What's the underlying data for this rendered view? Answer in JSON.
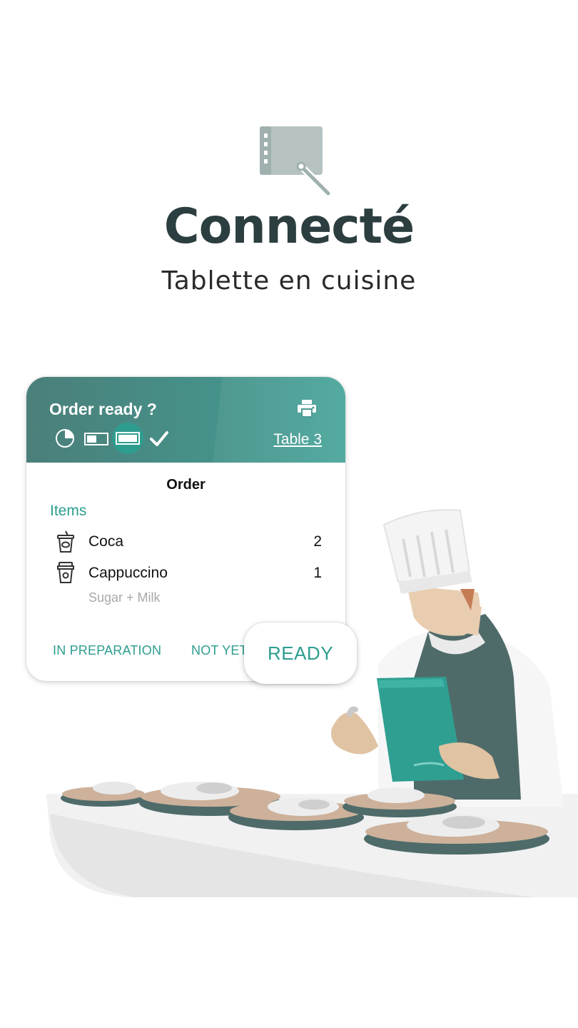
{
  "hero": {
    "icon": "kitchen-tablet-icon",
    "title": "Connecté",
    "subtitle": "Tablette en cuisine"
  },
  "order_card": {
    "header_title": "Order ready ?",
    "table_label": "Table 3",
    "status_steps": [
      "pie-clock-icon",
      "half-bar-icon",
      "full-bar-icon",
      "check-icon"
    ],
    "active_step": 2,
    "section_title": "Order",
    "items_label": "Items",
    "items": [
      {
        "icon": "cup-icon",
        "name": "Coca",
        "qty": "2"
      },
      {
        "icon": "coffee-cup-icon",
        "name": "Cappuccino",
        "qty": "1",
        "note": "Sugar + Milk"
      }
    ],
    "actions": {
      "in_preparation": "IN PREPARATION",
      "not_yet": "NOT YET",
      "ready": "READY"
    }
  },
  "colors": {
    "accent": "#2d9d8f",
    "header_dark": "#4b7f7a",
    "title_text": "#2c3e3f"
  }
}
